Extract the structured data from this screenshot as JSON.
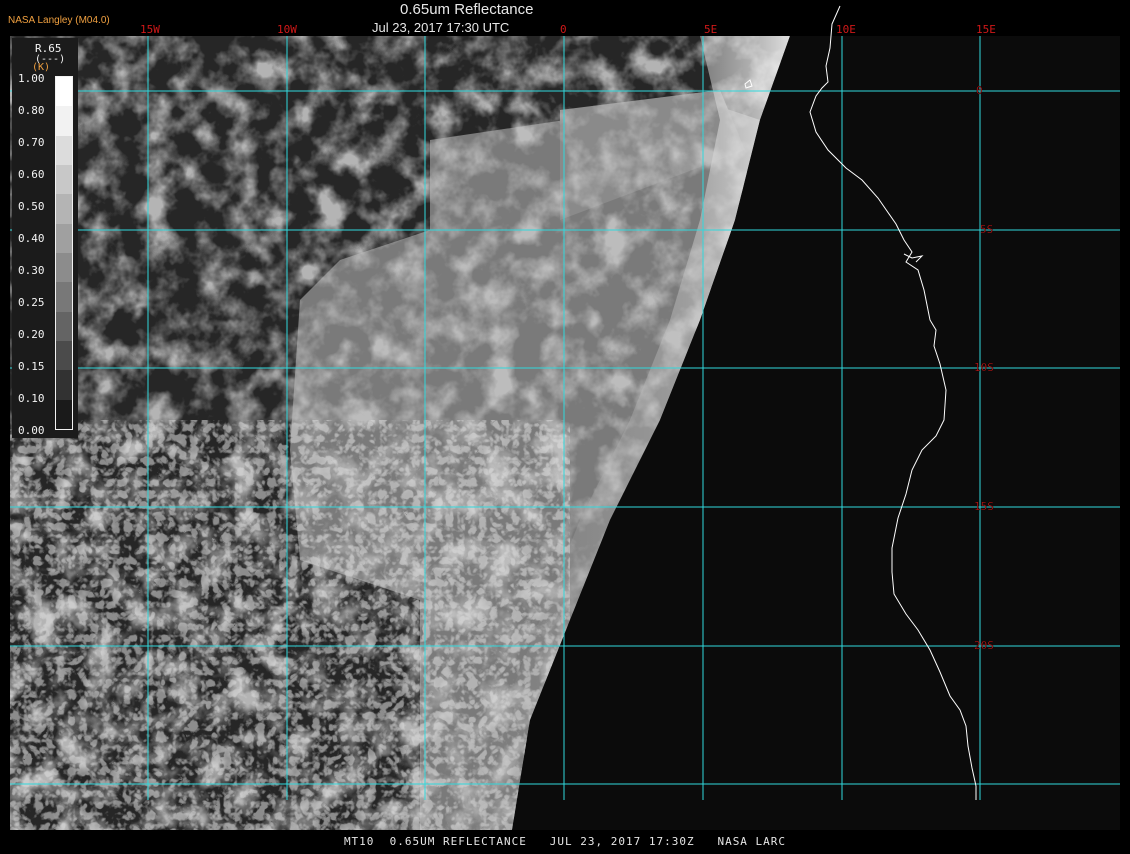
{
  "header": {
    "credit": "NASA Langley (M04.0)",
    "title": "0.65um Reflectance",
    "subtitle": "Jul 23, 2017 17:30 UTC"
  },
  "footer": "MT10  0.65UM REFLECTANCE   JUL 23, 2017 17:30Z   NASA LARC",
  "grid": {
    "color": "#30d8dc",
    "label_color": "#d01818",
    "longitudes": [
      "15W",
      "10W",
      "0",
      "5E",
      "10E",
      "15E"
    ],
    "latitudes": [
      "0",
      "5S",
      "10S",
      "15S",
      "20S"
    ]
  },
  "legend": {
    "param": "R.65",
    "unit": "(---)",
    "extra": "(K)",
    "ticks": [
      "1.00",
      "0.80",
      "0.70",
      "0.60",
      "0.50",
      "0.40",
      "0.30",
      "0.25",
      "0.20",
      "0.15",
      "0.10",
      "0.00"
    ]
  },
  "map": {
    "coastline_color": "#ffffff",
    "terminator": "dayside on left, night on right of terminator",
    "space_color": "#0c0c0c"
  }
}
